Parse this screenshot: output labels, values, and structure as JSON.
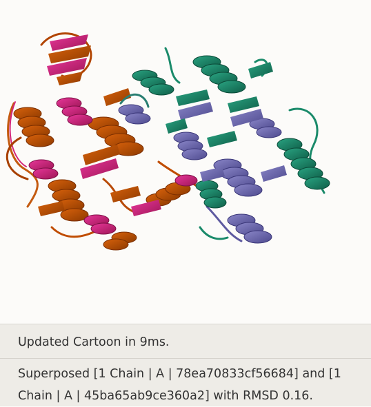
{
  "viewer": {
    "structure_a_colors": [
      "#c04c00",
      "#d4267a"
    ],
    "structure_b_colors": [
      "#1a8a6a",
      "#6e6ab0"
    ]
  },
  "log": {
    "entries": [
      {
        "text": "Updated Cartoon in 9ms."
      },
      {
        "text": "Superposed [1 Chain | A | 78ea70833cf56684] and [1 Chain | A | 45ba65ab9ce360a2] with RMSD 0.16."
      }
    ]
  }
}
